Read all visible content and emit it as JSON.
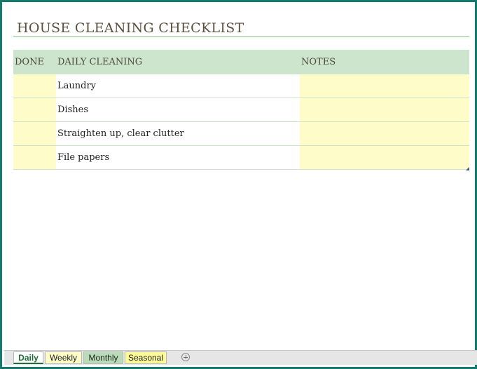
{
  "sheet": {
    "title": "HOUSE CLEANING CHECKLIST"
  },
  "table": {
    "headers": {
      "done": "DONE",
      "task": "DAILY CLEANING",
      "notes": "NOTES"
    },
    "rows": [
      {
        "done": "",
        "task": "Laundry",
        "notes": ""
      },
      {
        "done": "",
        "task": "Dishes",
        "notes": ""
      },
      {
        "done": "",
        "task": "Straighten up, clear clutter",
        "notes": ""
      },
      {
        "done": "",
        "task": "File papers",
        "notes": ""
      }
    ]
  },
  "tabs": [
    {
      "label": "Daily",
      "active": true,
      "color": "#ffffff"
    },
    {
      "label": "Weekly",
      "active": false,
      "color": "#fffcc7"
    },
    {
      "label": "Monthly",
      "active": false,
      "color": "#b7dcb6"
    },
    {
      "label": "Seasonal",
      "active": false,
      "color": "#fdfa97"
    }
  ],
  "add_sheet_icon": "plus-circle-icon",
  "colors": {
    "frame": "#157a6e",
    "title": "#5b5141",
    "header_fill": "#cde5cc",
    "input_fill": "#fefcc9"
  }
}
